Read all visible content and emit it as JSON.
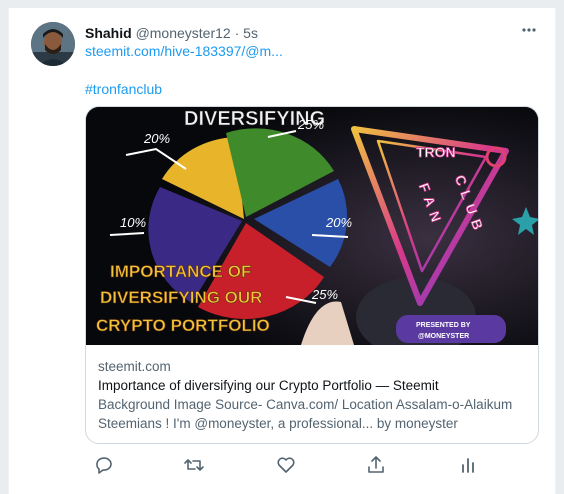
{
  "tweet": {
    "author_name": "Shahid",
    "handle": "@moneyster12",
    "separator": "·",
    "time": "5s",
    "link_text": "steemit.com/hive-183397/@m...",
    "hashtag": "#tronfanclub"
  },
  "card": {
    "domain": "steemit.com",
    "title": "Importance of diversifying our Crypto Portfolio — Steemit",
    "description_line1": "Background Image Source- Canva.com/ Location Assalam-o-Alaikum",
    "description_line2": "Steemians ! I'm @moneyster, a professional... by moneyster",
    "image": {
      "heading": "DIVERSIFYING",
      "pie_labels": [
        "20%",
        "25%",
        "10%",
        "20%",
        "25%"
      ],
      "title_line1": "IMPORTANCE OF",
      "title_line2": "DIVERSIFYING OUR",
      "title_line3": "CRYPTO PORTFOLIO",
      "logo_top": "TRON",
      "logo_left": "FAN",
      "logo_right": "CLUB",
      "presented_line1": "PRESENTED BY",
      "presented_line2": "@MONEYSTER",
      "pie_colors": [
        "#e8b52a",
        "#3f8a2a",
        "#2a4fa8",
        "#c8202a",
        "#3a2a86"
      ]
    }
  },
  "icons": [
    "more-icon",
    "reply-icon",
    "retweet-icon",
    "like-icon",
    "share-icon",
    "analytics-icon"
  ]
}
